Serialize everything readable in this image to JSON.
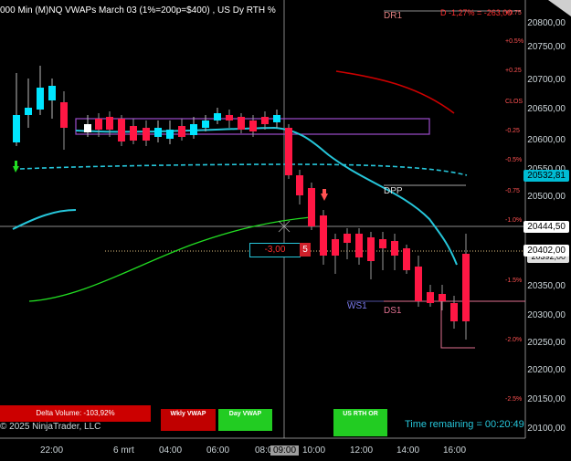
{
  "chart_title": "000 Min (M)NQ VWAPs March 03 (1%=200p=$400) , US Dy RTH %",
  "drawdown_text": "D -1,27% = -263,00",
  "copyright": "© 2025 NinjaTrader, LLC",
  "time_remaining": "Time remaining = 00:20:49",
  "delta_volume": "Delta Volume: -103,92%",
  "buttons": {
    "weekly_vwap": "Wkly VWAP",
    "day_vwap": "Day VWAP",
    "us_rth_or": "US RTH OR"
  },
  "levels": {
    "dr1": "DR1",
    "dpp": "DPP",
    "ws1": "WS1",
    "ds1": "DS1",
    "clos": "CLOS"
  },
  "order": {
    "price": "-3,00",
    "qty": "5"
  },
  "tags": {
    "vwap": "20532,81",
    "crosshair": "20444,50",
    "last": "20402,00",
    "hidden": "20392,00"
  },
  "price_axis": [
    "20800,00",
    "20750,00",
    "20700,00",
    "20650,00",
    "20600,00",
    "20550,00",
    "20500,00",
    "20450,00",
    "20400,00",
    "20350,00",
    "20300,00",
    "20250,00",
    "20200,00",
    "20150,00",
    "20100,00"
  ],
  "pct_axis": [
    {
      "label": "+0.75",
      "color": "#ff5252"
    },
    {
      "label": "+0.5%",
      "color": "#ff5252"
    },
    {
      "label": "+0.25",
      "color": "#ff5252"
    },
    {
      "label": "CLOS",
      "color": "#ff5252"
    },
    {
      "label": "-0.25",
      "color": "#ff5252"
    },
    {
      "label": "-0.5%",
      "color": "#ff5252"
    },
    {
      "label": "-0.75",
      "color": "#ff5252"
    },
    {
      "label": "-1.0%",
      "color": "#ff5252"
    },
    {
      "label": "-1.5%",
      "color": "#ff5252"
    },
    {
      "label": "-2.0%",
      "color": "#ff5252"
    },
    {
      "label": "-2.5%",
      "color": "#ff5252"
    }
  ],
  "time_axis": [
    "22:00",
    "6 mrt",
    "04:00",
    "06:00",
    "08:00",
    "09:00",
    "10:00",
    "12:00",
    "14:00",
    "16:00"
  ],
  "colors": {
    "up": "#00e5ff",
    "down": "#ff1744",
    "vwap": "#26c6da",
    "green": "#22dd22",
    "red": "#cc0000",
    "accent": "#00bcd4"
  }
}
